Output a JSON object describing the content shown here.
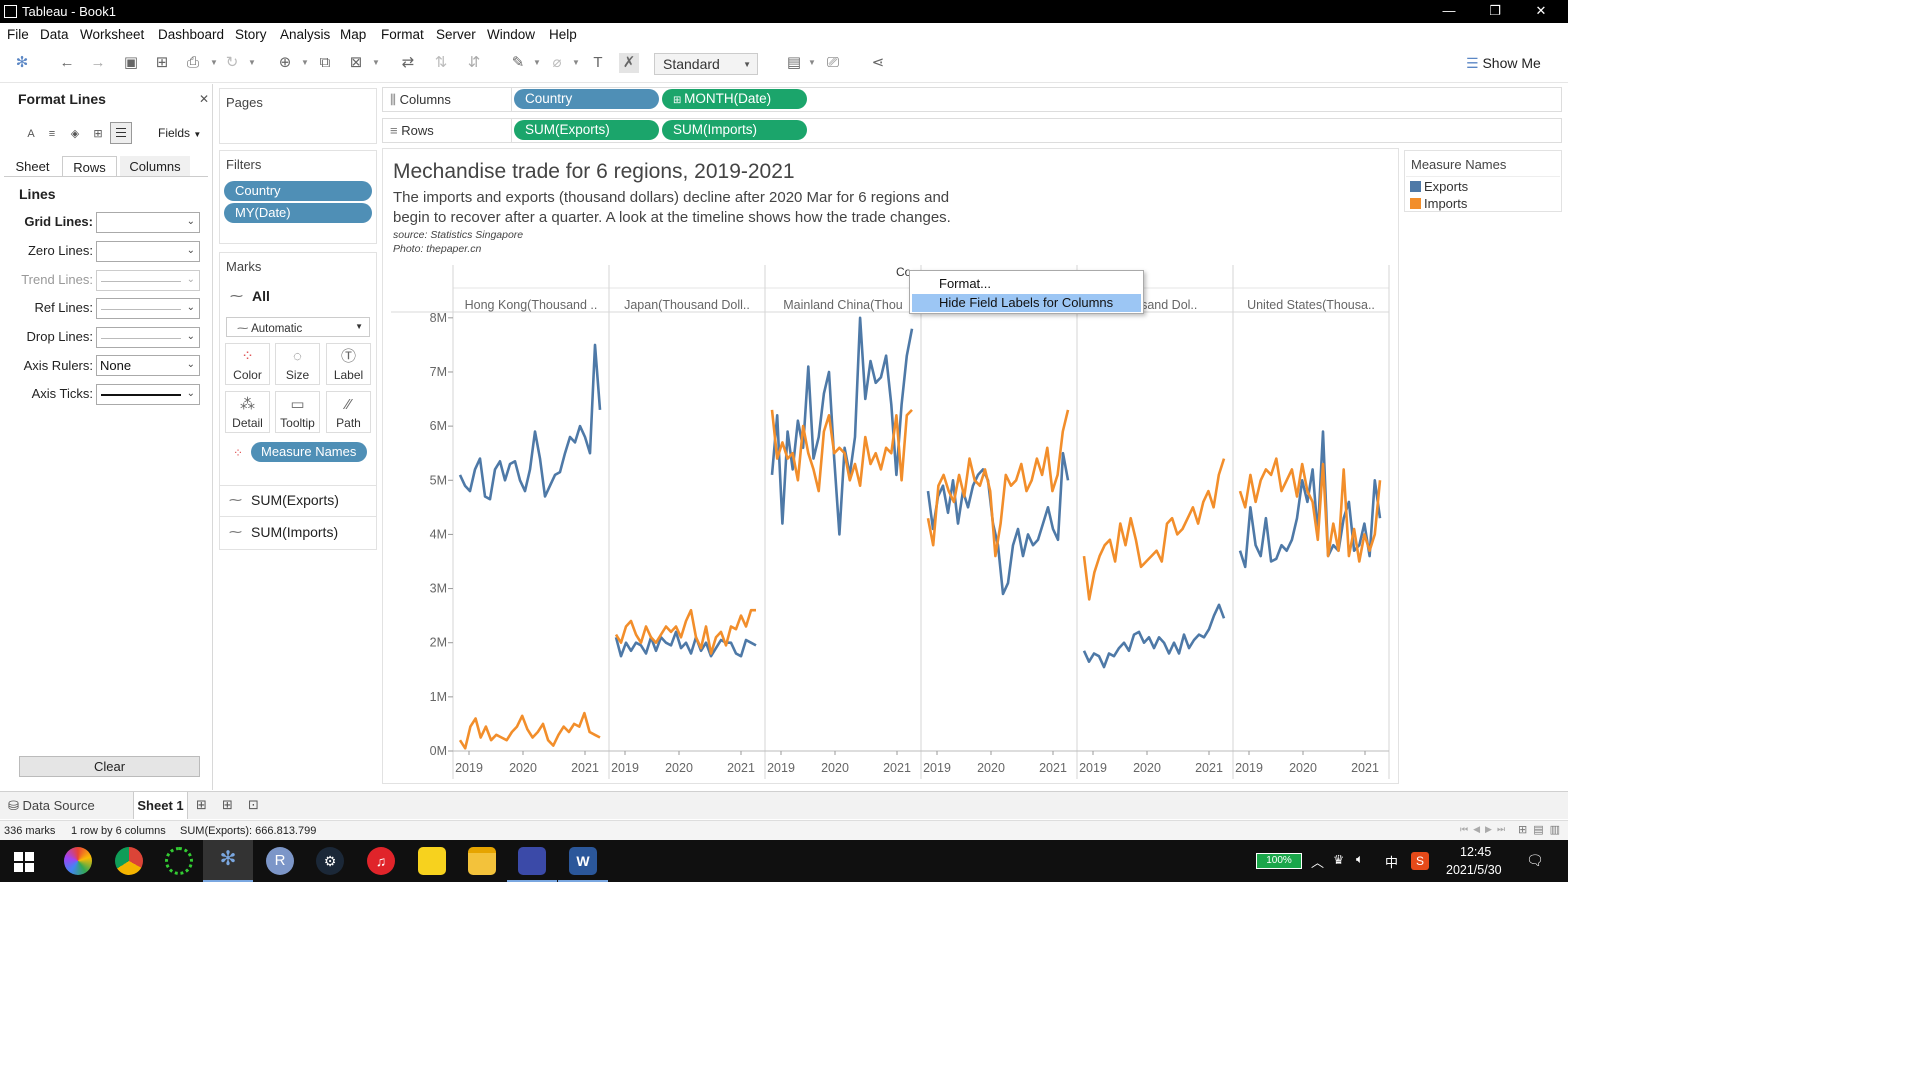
{
  "window": {
    "title": "Tableau - Book1",
    "minimize": "—",
    "maximize": "❐",
    "close": "✕"
  },
  "menu": [
    "File",
    "Data",
    "Worksheet",
    "Dashboard",
    "Story",
    "Analysis",
    "Map",
    "Format",
    "Server",
    "Window",
    "Help"
  ],
  "toolbar": {
    "fit": "Standard",
    "show_me": "Show Me"
  },
  "format_pane": {
    "title": "Format Lines",
    "fields_label": "Fields",
    "tabs": [
      "Sheet",
      "Rows",
      "Columns"
    ],
    "active_tab": "Rows",
    "section": "Lines",
    "rows": [
      {
        "label": "Grid Lines:",
        "value": ""
      },
      {
        "label": "Zero Lines:",
        "value": ""
      },
      {
        "label": "Trend Lines:",
        "value": ""
      },
      {
        "label": "Ref Lines:",
        "value": ""
      },
      {
        "label": "Drop Lines:",
        "value": ""
      },
      {
        "label": "Axis Rulers:",
        "value": "None"
      },
      {
        "label": "Axis Ticks:",
        "value": ""
      }
    ],
    "clear": "Clear"
  },
  "cards": {
    "pages": "Pages",
    "filters": "Filters",
    "filter_pills": [
      "Country",
      "MY(Date)"
    ],
    "marks": "Marks",
    "marks_all": "All",
    "mark_type": "Automatic",
    "buttons": [
      {
        "label": "Color",
        "icon": "color-icon"
      },
      {
        "label": "Size",
        "icon": "size-icon"
      },
      {
        "label": "Label",
        "icon": "label-icon"
      },
      {
        "label": "Detail",
        "icon": "detail-icon"
      },
      {
        "label": "Tooltip",
        "icon": "tooltip-icon"
      },
      {
        "label": "Path",
        "icon": "path-icon"
      }
    ],
    "color_pill": "Measure Names",
    "measures": [
      "SUM(Exports)",
      "SUM(Imports)"
    ]
  },
  "shelves": {
    "columns_label": "Columns",
    "rows_label": "Rows",
    "columns": [
      "Country",
      "MONTH(Date)"
    ],
    "rows": [
      "SUM(Exports)",
      "SUM(Imports)"
    ]
  },
  "view": {
    "title": "Mechandise trade for  6 regions, 2019-2021",
    "subtitle_1": "The imports and exports (thousand dollars) decline after 2020 Mar for 6 regions and",
    "subtitle_2": "begin to recover after a quarter. A look at the timeline shows how the trade changes.",
    "source": "source: Statistics Singapore",
    "photo": "Photo: thepaper.cn",
    "header_partial": "Co"
  },
  "context_menu": {
    "format": "Format...",
    "hide": "Hide Field Labels for Columns"
  },
  "legend": {
    "title": "Measure Names",
    "items": [
      {
        "label": "Exports",
        "color": "#4e79a7"
      },
      {
        "label": "Imports",
        "color": "#f28e2b"
      }
    ]
  },
  "chart_data": {
    "type": "line",
    "panel_headers": [
      "Hong Kong(Thousand ..",
      "Japan(Thousand Doll..",
      "Mainland China(Thou",
      "",
      "Thousand Dol..",
      "United States(Thousa.."
    ],
    "x_ticks": [
      "2019",
      "2020",
      "2021"
    ],
    "y_ticks": [
      "0M",
      "1M",
      "2M",
      "3M",
      "4M",
      "5M",
      "6M",
      "7M",
      "8M"
    ],
    "ylim": [
      0,
      8200000
    ],
    "series": [
      {
        "name": "Exports",
        "color": "#4e79a7",
        "panels": [
          [
            5.1,
            4.9,
            4.8,
            5.2,
            5.4,
            4.7,
            4.65,
            5.2,
            5.35,
            5.0,
            5.3,
            5.35,
            5.0,
            4.8,
            5.2,
            5.9,
            5.4,
            4.7,
            4.9,
            5.1,
            5.15,
            5.5,
            5.8,
            5.7,
            6.0,
            5.8,
            5.5,
            7.5,
            6.3
          ],
          [
            2.1,
            1.75,
            2.0,
            1.85,
            2.0,
            1.95,
            1.8,
            2.1,
            1.85,
            2.1,
            2.0,
            1.95,
            2.2,
            1.9,
            2.0,
            1.8,
            2.1,
            1.85,
            2.0,
            1.75,
            1.9,
            2.05,
            2.0,
            2.0,
            1.8,
            1.75,
            2.05,
            2.0,
            1.95
          ],
          [
            5.1,
            6.2,
            4.2,
            5.9,
            5.2,
            6.1,
            5.6,
            7.1,
            5.4,
            5.8,
            6.6,
            7.0,
            5.4,
            4.0,
            5.6,
            5.1,
            5.8,
            8.0,
            6.5,
            7.2,
            6.8,
            6.9,
            7.3,
            6.4,
            5.1,
            6.4,
            7.3,
            7.8
          ],
          [
            4.8,
            4.1,
            4.7,
            4.9,
            4.4,
            5.0,
            4.2,
            4.8,
            4.5,
            4.9,
            5.1,
            5.2,
            5.0,
            4.2,
            3.8,
            2.9,
            3.1,
            3.8,
            4.1,
            3.6,
            4.0,
            3.8,
            3.9,
            4.2,
            4.5,
            4.1,
            3.9,
            5.5,
            5.0
          ],
          [
            1.85,
            1.65,
            1.8,
            1.75,
            1.55,
            1.8,
            1.75,
            1.9,
            2.0,
            1.85,
            2.15,
            2.2,
            2.0,
            2.1,
            1.9,
            2.1,
            2.0,
            1.8,
            2.0,
            1.8,
            2.15,
            1.9,
            2.05,
            2.15,
            2.1,
            2.25,
            2.5,
            2.7,
            2.45
          ],
          [
            3.7,
            3.4,
            4.5,
            3.8,
            3.6,
            4.3,
            3.5,
            3.55,
            3.8,
            3.7,
            3.9,
            4.3,
            5.0,
            4.6,
            5.2,
            4.0,
            5.9,
            3.6,
            3.8,
            3.7,
            4.3,
            4.6,
            3.7,
            3.8,
            4.2,
            3.6,
            5.0,
            4.3
          ]
        ]
      },
      {
        "name": "Imports",
        "color": "#f28e2b",
        "panels": [
          [
            0.2,
            0.05,
            0.45,
            0.6,
            0.25,
            0.45,
            0.2,
            0.3,
            0.25,
            0.2,
            0.35,
            0.45,
            0.65,
            0.4,
            0.25,
            0.35,
            0.5,
            0.2,
            0.1,
            0.3,
            0.45,
            0.35,
            0.5,
            0.45,
            0.7,
            0.35,
            0.3,
            0.25
          ],
          [
            2.15,
            2.0,
            2.3,
            2.4,
            2.15,
            2.0,
            2.3,
            2.1,
            2.0,
            2.15,
            2.3,
            2.2,
            2.3,
            2.1,
            2.4,
            2.6,
            2.1,
            1.9,
            2.3,
            1.8,
            2.1,
            2.2,
            1.95,
            2.3,
            2.25,
            2.5,
            2.3,
            2.6,
            2.6
          ],
          [
            6.3,
            5.4,
            5.7,
            5.4,
            5.5,
            5.0,
            6.0,
            5.5,
            5.2,
            4.8,
            5.9,
            6.2,
            5.5,
            5.6,
            5.5,
            5.0,
            5.3,
            4.9,
            5.8,
            5.3,
            5.5,
            5.2,
            5.6,
            5.5,
            6.2,
            5.0,
            6.2,
            6.3
          ],
          [
            4.3,
            3.8,
            4.9,
            5.1,
            4.8,
            4.6,
            5.1,
            4.7,
            5.4,
            5.0,
            4.9,
            5.2,
            4.8,
            3.6,
            4.2,
            5.1,
            4.9,
            5.0,
            5.3,
            4.8,
            5.0,
            5.4,
            5.1,
            5.6,
            4.8,
            5.1,
            5.9,
            6.3
          ],
          [
            3.6,
            2.8,
            3.3,
            3.6,
            3.8,
            3.9,
            3.5,
            4.2,
            3.8,
            4.3,
            3.9,
            3.4,
            3.5,
            3.6,
            3.7,
            3.5,
            4.2,
            4.3,
            4.0,
            4.1,
            4.3,
            4.5,
            4.2,
            4.6,
            4.8,
            4.5,
            5.1,
            5.4
          ],
          [
            4.8,
            4.5,
            5.1,
            4.6,
            5.0,
            5.2,
            5.1,
            5.4,
            4.8,
            5.0,
            5.2,
            4.7,
            5.3,
            4.8,
            4.6,
            3.9,
            5.3,
            3.6,
            4.2,
            3.7,
            5.2,
            3.6,
            4.1,
            3.5,
            4.0,
            3.7,
            4.0,
            5.0
          ]
        ]
      }
    ]
  },
  "bottom_tabs": {
    "data_source": "Data Source",
    "sheet": "Sheet 1"
  },
  "status": {
    "marks": "336 marks",
    "rows": "1 row by 6 columns",
    "sum": "SUM(Exports): 666.813.799"
  },
  "taskbar": {
    "battery": "100%",
    "ime": "中",
    "time": "12:45",
    "date": "2021/5/30"
  }
}
